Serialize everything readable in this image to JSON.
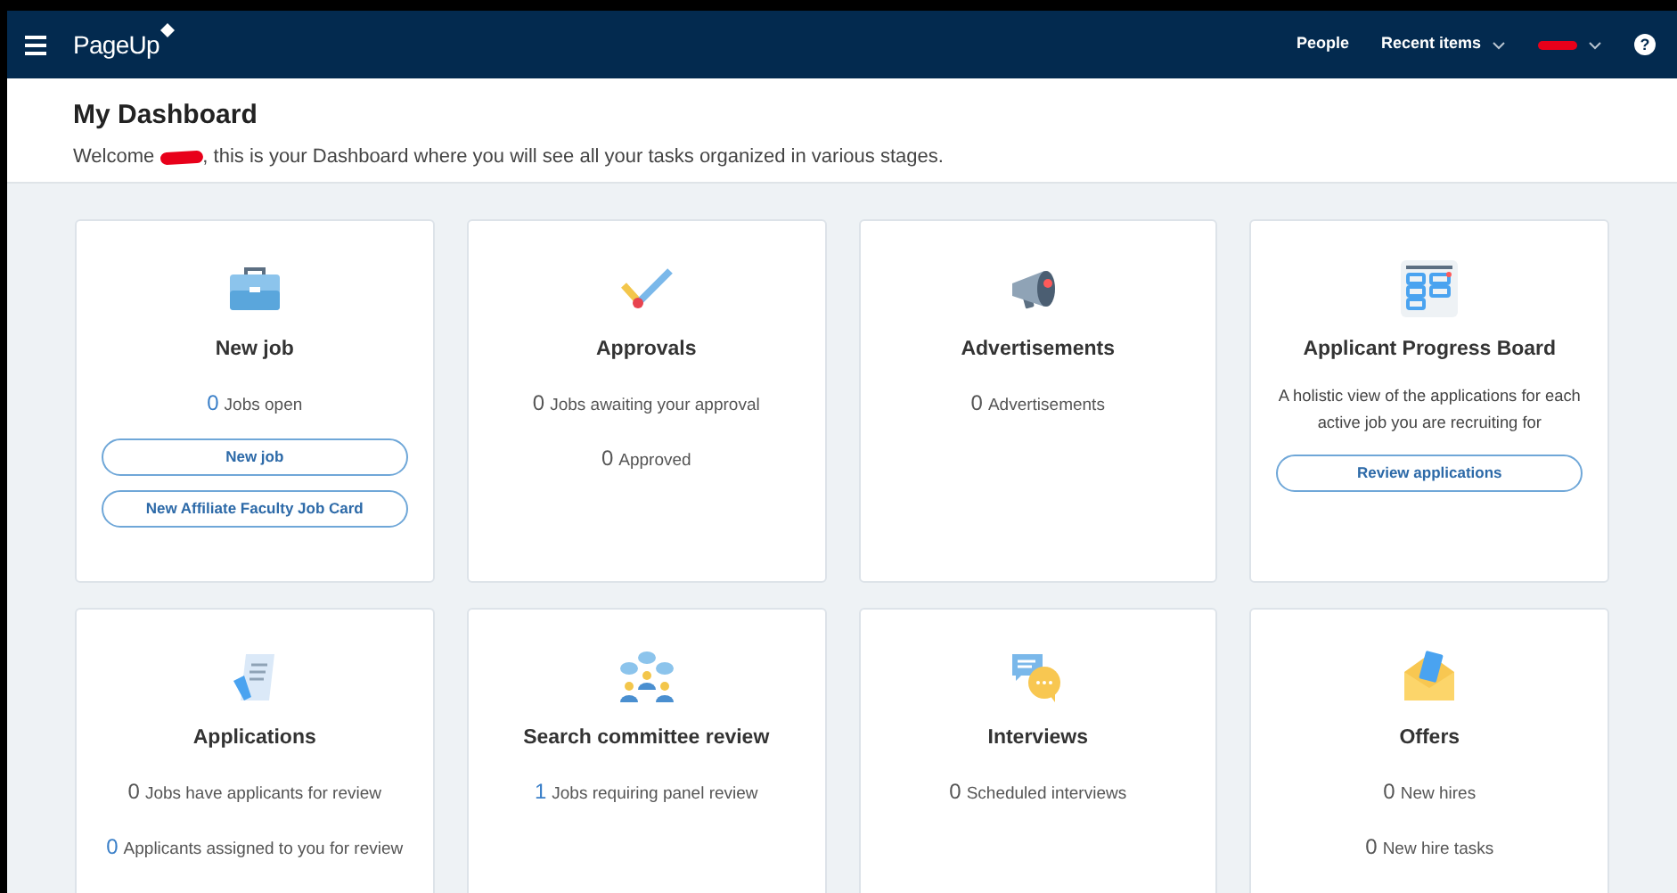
{
  "header": {
    "logo": "PageUp",
    "nav": [
      {
        "label": "People",
        "kind": "link"
      },
      {
        "label": "Recent items",
        "kind": "dropdown"
      },
      {
        "kind": "user"
      }
    ],
    "help": "?"
  },
  "page": {
    "title": "My Dashboard",
    "welcome_before": "Welcome",
    "welcome_after": ", this is your Dashboard where you will see all your tasks organized in various stages."
  },
  "cards": [
    {
      "kind": "briefcase",
      "title": "New job",
      "stats": [
        {
          "count": "0",
          "label": "Jobs open",
          "link": true
        }
      ],
      "buttons": [
        "New job",
        "New Affiliate Faculty Job Card"
      ]
    },
    {
      "kind": "check",
      "title": "Approvals",
      "stats": [
        {
          "count": "0",
          "label": "Jobs awaiting your approval",
          "link": false
        },
        {
          "count": "0",
          "label": "Approved",
          "link": false
        }
      ]
    },
    {
      "kind": "megaphone",
      "title": "Advertisements",
      "stats": [
        {
          "count": "0",
          "label": "Advertisements",
          "link": false
        }
      ]
    },
    {
      "kind": "board",
      "title": "Applicant Progress Board",
      "description": "A holistic view of the applications for each active job you are recruiting for",
      "buttons": [
        "Review applications"
      ]
    },
    {
      "kind": "document",
      "title": "Applications",
      "stats": [
        {
          "count": "0",
          "label": "Jobs have applicants for review",
          "link": false
        },
        {
          "count": "0",
          "label": "Applicants assigned to you for review",
          "link": true
        }
      ]
    },
    {
      "kind": "committee",
      "title": "Search committee review",
      "stats": [
        {
          "count": "1",
          "label": "Jobs requiring panel review",
          "link": true
        }
      ]
    },
    {
      "kind": "chat",
      "title": "Interviews",
      "stats": [
        {
          "count": "0",
          "label": "Scheduled interviews",
          "link": false
        }
      ]
    },
    {
      "kind": "envelope",
      "title": "Offers",
      "stats": [
        {
          "count": "0",
          "label": "New hires",
          "link": false
        },
        {
          "count": "0",
          "label": "New hire tasks",
          "link": false
        }
      ]
    }
  ]
}
